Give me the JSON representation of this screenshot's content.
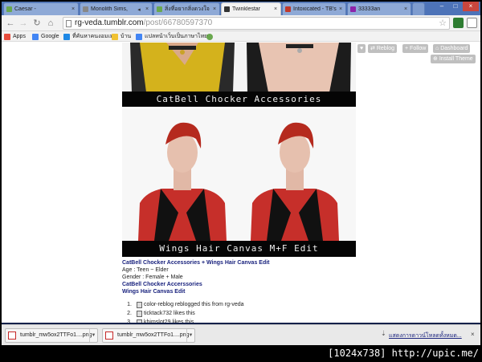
{
  "browser": {
    "tabs": [
      {
        "label": "Caesar -",
        "favicon_color": "#6aa84f"
      },
      {
        "label": "Monolith Sims,",
        "favicon_color": "#888888"
      },
      {
        "label": "สิ่งที่อยากสิ่งดวงใจ",
        "favicon_color": "#6aa84f"
      },
      {
        "label": "Twinklestar",
        "favicon_color": "#333333",
        "active": true
      },
      {
        "label": "Intoxicated - TB's",
        "favicon_color": "#c0392b"
      },
      {
        "label": "33333an",
        "favicon_color": "#8e24aa"
      }
    ],
    "window_controls": {
      "minimize": "–",
      "maximize": "□",
      "close": "×"
    },
    "url_host": "rg-veda.tumblr.com",
    "url_path": "/post/66780597370",
    "bookmarks": [
      {
        "label": "Apps",
        "icon": "apps-grid-icon",
        "color": "#e74c3c"
      },
      {
        "label": "Google",
        "icon": "google-icon",
        "color": "#4285f4"
      },
      {
        "label": "ที่คันหาคนงอมเมนู",
        "icon": "globe-icon",
        "color": "#1e88e5"
      },
      {
        "label": "บ้าน",
        "icon": "folder-icon",
        "color": "#f1c232"
      },
      {
        "label": "แปลหน้าเว็บเป็นภาษาไทย...",
        "icon": "translate-icon",
        "color": "#4285f4"
      },
      {
        "label": "",
        "icon": "leaf-icon",
        "color": "#6aa84f"
      }
    ]
  },
  "tumblr": {
    "reblog": "Reblog",
    "follow": "Follow",
    "dashboard": "Dashboard",
    "install_theme": "Install Theme"
  },
  "post": {
    "caption1": "CatBell Chocker Accessories",
    "caption2": "Wings Hair Canvas M+F Edit",
    "title_line": "CatBell Chocker Accessories + Wings Hair Canvas Edit",
    "age": "Age : Teen ~ Elder",
    "gender": "Gender : Female + Male",
    "item1": "CatBell Chocker Accerssories",
    "item2": "Wings Hair Canvas Edit",
    "notes": [
      {
        "num": "1.",
        "text": "color-reblog reblogged this from rg-veda"
      },
      {
        "num": "2.",
        "text": "ticktack732 likes this"
      },
      {
        "num": "3.",
        "text": "khimslot29 likes this"
      }
    ]
  },
  "downloads": {
    "items": [
      {
        "name": "tumblr_mw5ox2TTFo1....png"
      },
      {
        "name": "tumblr_mw5ox2TTFo1....png"
      }
    ],
    "show_all": "แสดงการดาวน์โหลดทั้งหมด...",
    "close": "×"
  },
  "footer": "[1024x738] http://upic.me/"
}
